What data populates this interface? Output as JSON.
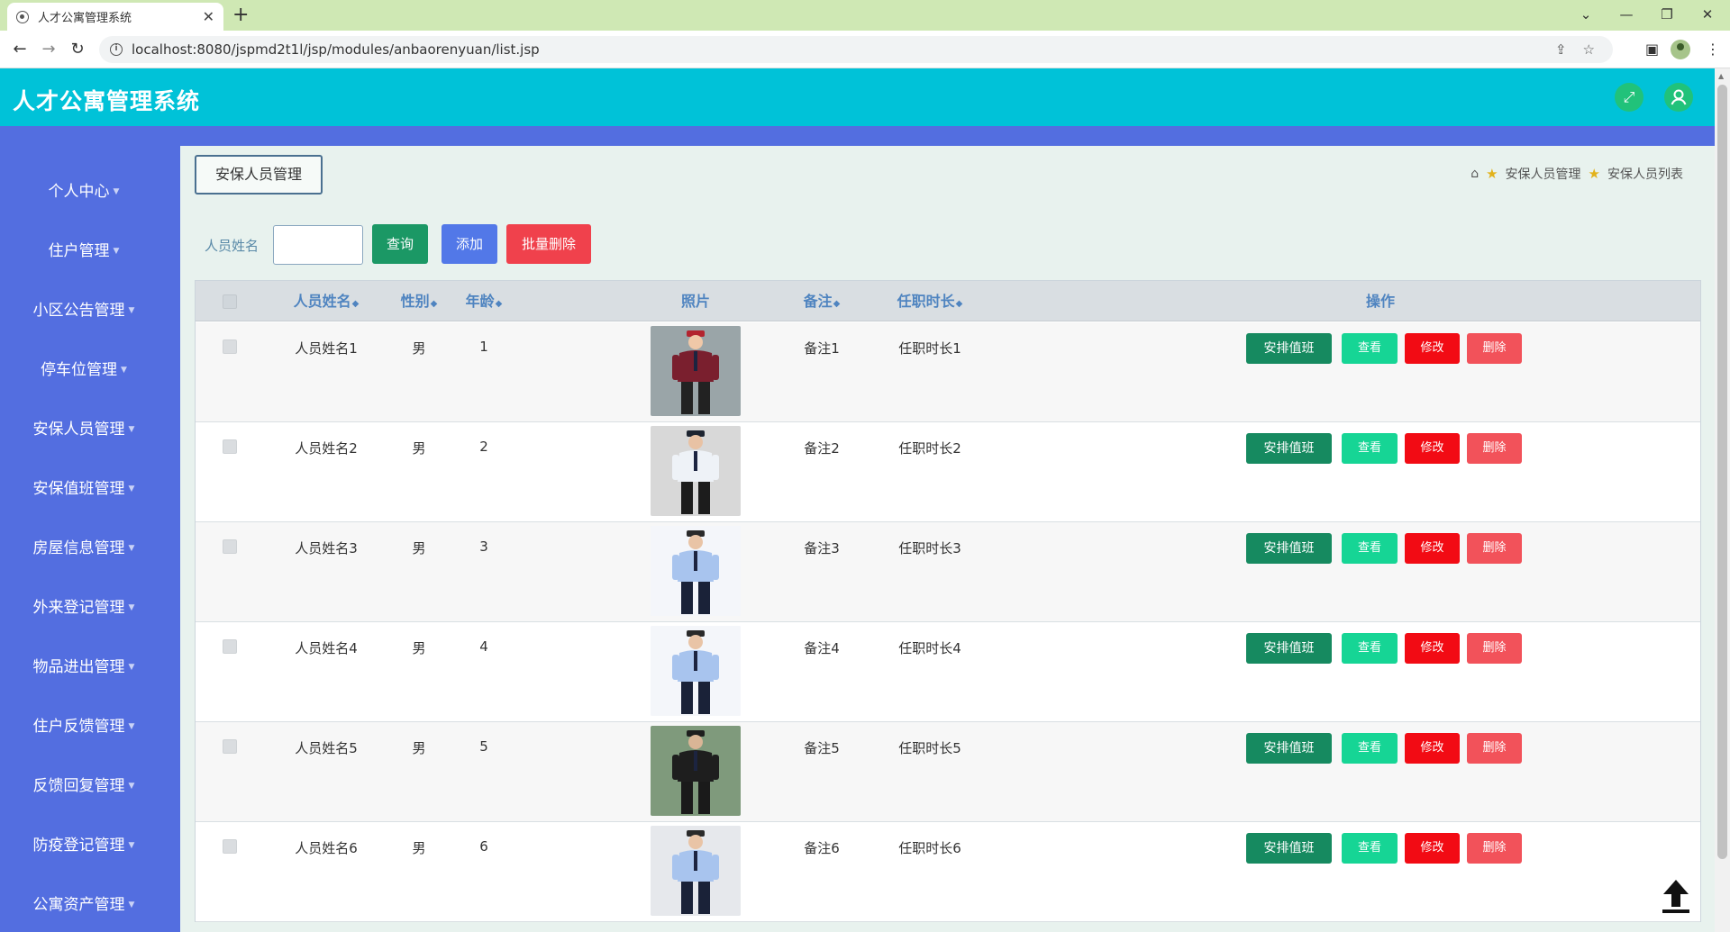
{
  "browser": {
    "tab_title": "人才公寓管理系统",
    "tab_close": "✕",
    "new_tab": "+",
    "url": "localhost:8080/jspmd2t1l/jsp/modules/anbaorenyuan/list.jsp",
    "controls": {
      "minimize": "—",
      "restore": "❐",
      "close": "✕",
      "tab_search": "⌄"
    }
  },
  "header": {
    "title": "人才公寓管理系统",
    "fullscreen_icon": "fullscreen-icon",
    "user_icon": "user-icon"
  },
  "sidebar": {
    "items": [
      {
        "label": "个人中心"
      },
      {
        "label": "住户管理"
      },
      {
        "label": "小区公告管理"
      },
      {
        "label": "停车位管理"
      },
      {
        "label": "安保人员管理"
      },
      {
        "label": "安保值班管理"
      },
      {
        "label": "房屋信息管理"
      },
      {
        "label": "外来登记管理"
      },
      {
        "label": "物品进出管理"
      },
      {
        "label": "住户反馈管理"
      },
      {
        "label": "反馈回复管理"
      },
      {
        "label": "防疫登记管理"
      },
      {
        "label": "公寓资产管理"
      }
    ]
  },
  "main": {
    "page_tag": "安保人员管理",
    "breadcrumb": {
      "level1": "安保人员管理",
      "level2": "安保人员列表"
    },
    "search": {
      "label": "人员姓名",
      "value": "",
      "placeholder": ""
    },
    "buttons": {
      "query": "查询",
      "add": "添加",
      "batch_delete": "批量删除"
    }
  },
  "table": {
    "columns": [
      "人员姓名",
      "性别",
      "年龄",
      "照片",
      "备注",
      "任职时长",
      "操作"
    ],
    "rows": [
      {
        "name": "人员姓名1",
        "gender": "男",
        "age": "1",
        "remark": "备注1",
        "tenure": "任职时长1"
      },
      {
        "name": "人员姓名2",
        "gender": "男",
        "age": "2",
        "remark": "备注2",
        "tenure": "任职时长2"
      },
      {
        "name": "人员姓名3",
        "gender": "男",
        "age": "3",
        "remark": "备注3",
        "tenure": "任职时长3"
      },
      {
        "name": "人员姓名4",
        "gender": "男",
        "age": "4",
        "remark": "备注4",
        "tenure": "任职时长4"
      },
      {
        "name": "人员姓名5",
        "gender": "男",
        "age": "5",
        "remark": "备注5",
        "tenure": "任职时长5"
      },
      {
        "name": "人员姓名6",
        "gender": "男",
        "age": "6",
        "remark": "备注6",
        "tenure": "任职时长6"
      }
    ],
    "actions": {
      "duty": "安排值班",
      "view": "查看",
      "edit": "修改",
      "delete": "删除"
    }
  },
  "colors": {
    "header": "#00c2d8",
    "sidebar": "#536ee0",
    "query": "#1b9865",
    "add": "#5278e8",
    "batch_delete": "#f0414c",
    "duty": "#168a60",
    "view": "#16d595",
    "edit": "#f20b14",
    "delete": "#f2525a"
  }
}
